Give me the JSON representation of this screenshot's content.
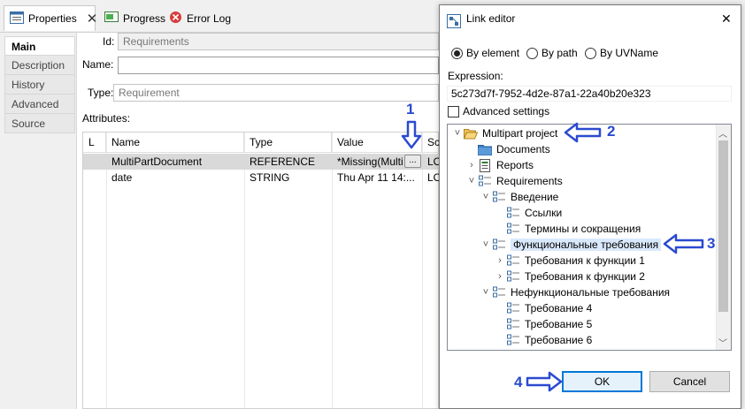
{
  "tabs": [
    {
      "label": "Properties",
      "icon": "properties-icon"
    },
    {
      "label": "Progress",
      "icon": "progress-icon"
    },
    {
      "label": "Error Log",
      "icon": "error-log-icon"
    }
  ],
  "side_tabs": [
    "Main",
    "Description",
    "History",
    "Advanced",
    "Source"
  ],
  "form": {
    "id_label": "Id:",
    "id_value": "Requirements",
    "name_label": "Name:",
    "name_value": "",
    "type_label": "Type:",
    "type_value": "Requirement",
    "attributes_label": "Attributes:"
  },
  "table": {
    "headers": [
      "L",
      "Name",
      "Type",
      "Value",
      "Sc"
    ],
    "rows": [
      {
        "name": "MultiPartDocument",
        "type": "REFERENCE",
        "value": "*Missing(Multi",
        "scope": "LO"
      },
      {
        "name": "date",
        "type": "STRING",
        "value": "Thu Apr 11 14:...",
        "scope": "LO"
      }
    ],
    "ellipsis_label": "..."
  },
  "dialog": {
    "title": "Link editor",
    "close_label": "✕",
    "radios": [
      {
        "label": "By element",
        "selected": true
      },
      {
        "label": "By path",
        "selected": false
      },
      {
        "label": "By UVName",
        "selected": false
      }
    ],
    "expression_label": "Expression:",
    "expression_value": "5c273d7f-7952-4d2e-87a1-22a40b20e323",
    "advanced_label": "Advanced settings",
    "tree": [
      {
        "label": "Multipart project",
        "icon": "folder-open-icon",
        "twisty": "˅"
      },
      {
        "label": "Documents",
        "icon": "folder-icon",
        "twisty": ""
      },
      {
        "label": "Reports",
        "icon": "report-icon",
        "twisty": "›"
      },
      {
        "label": "Requirements",
        "icon": "requirements-icon",
        "twisty": "˅"
      },
      {
        "label": "Введение",
        "icon": "requirements-icon",
        "twisty": "˅"
      },
      {
        "label": "Ссылки",
        "icon": "requirements-icon",
        "twisty": ""
      },
      {
        "label": "Термины и сокращения",
        "icon": "requirements-icon",
        "twisty": ""
      },
      {
        "label": "Функциональные требования",
        "icon": "requirements-icon",
        "twisty": "˅"
      },
      {
        "label": "Требования к функции 1",
        "icon": "requirements-icon",
        "twisty": "›"
      },
      {
        "label": "Требования к функции 2",
        "icon": "requirements-icon",
        "twisty": "›"
      },
      {
        "label": "Нефункциональные требования",
        "icon": "requirements-icon",
        "twisty": "˅"
      },
      {
        "label": "Требование 4",
        "icon": "requirements-icon",
        "twisty": ""
      },
      {
        "label": "Требование 5",
        "icon": "requirements-icon",
        "twisty": ""
      },
      {
        "label": "Требование 6",
        "icon": "requirements-icon",
        "twisty": ""
      }
    ],
    "ok_label": "OK",
    "cancel_label": "Cancel"
  },
  "annotations": [
    "1",
    "2",
    "3",
    "4"
  ],
  "colors": {
    "annotation": "#2b4ad0",
    "highlight": "#d9e8fb",
    "accent": "#0078d7"
  }
}
